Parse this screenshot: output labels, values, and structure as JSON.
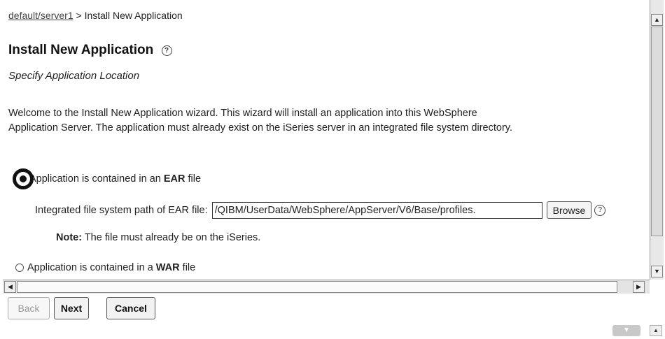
{
  "breadcrumb": {
    "link": "default/server1",
    "separator": ">",
    "current": "Install New Application"
  },
  "page": {
    "title": "Install New Application",
    "help_glyph": "?",
    "subtitle": "Specify Application Location",
    "intro_line1": "Welcome to the Install New Application wizard. This wizard will install an application into this WebSphere",
    "intro_line2": "Application Server. The application must already exist on the iSeries server in an integrated file system directory."
  },
  "options": {
    "ear": {
      "prefix": "Application is contained in an ",
      "type": "EAR",
      "suffix": " file",
      "selected": true
    },
    "war": {
      "prefix": "Application is contained in a ",
      "type": "WAR",
      "suffix": " file",
      "selected": false
    }
  },
  "ear_path": {
    "label": "Integrated file system path of EAR file:",
    "value": "/QIBM/UserData/WebSphere/AppServer/V6/Base/profiles.",
    "browse_label": "Browse"
  },
  "note": {
    "label": "Note:",
    "text": " The file must already be on the iSeries."
  },
  "buttons": {
    "back": "Back",
    "next": "Next",
    "cancel": "Cancel"
  },
  "icons": {
    "help": "help-icon",
    "scroll_up": "triangle-up-icon",
    "scroll_down": "triangle-down-icon",
    "scroll_left": "triangle-left-icon",
    "scroll_right": "triangle-right-icon"
  }
}
